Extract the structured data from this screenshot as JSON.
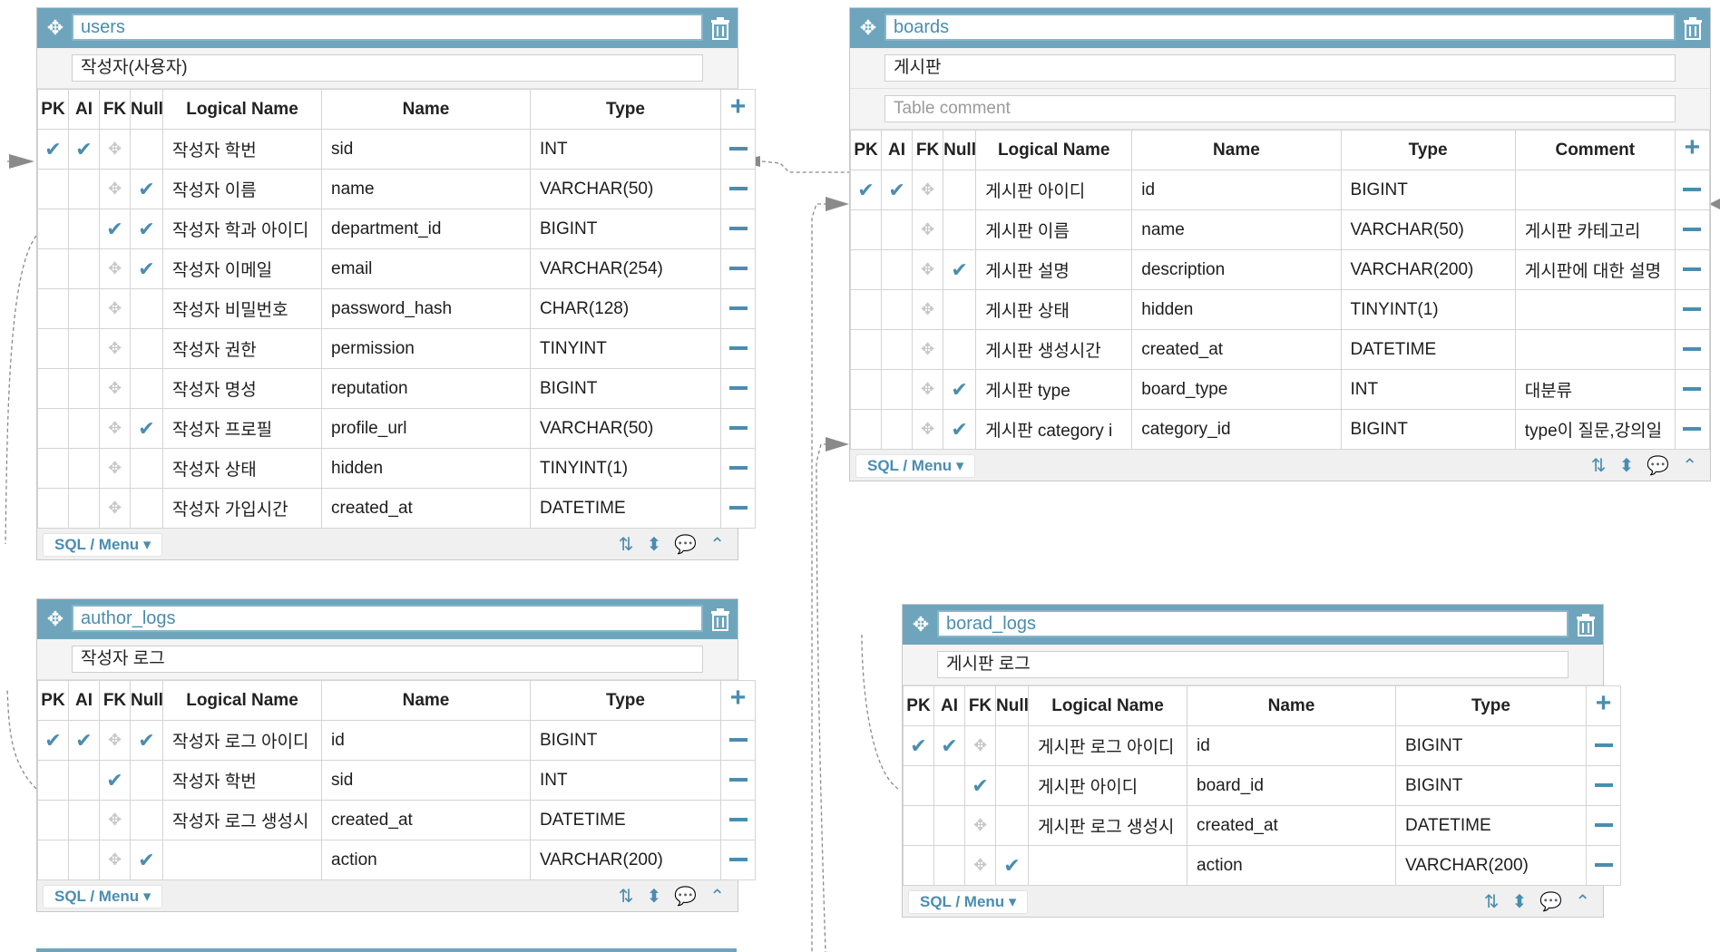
{
  "icons": {
    "move": "move-icon",
    "trash": "trash-icon",
    "check": "check-icon",
    "add": "plus-icon",
    "remove": "minus-icon",
    "sort": "sort-az-icon",
    "order": "sort-updown-icon",
    "comment": "comment-icon",
    "collapse": "chevron-up-icon"
  },
  "colors": {
    "accent": "#6ea5bd",
    "link": "#4a8db0"
  },
  "ui": {
    "sql_menu_label": "SQL / Menu ▾"
  },
  "headers": {
    "pk": "PK",
    "ai": "AI",
    "fk": "FK",
    "null": "Null",
    "logical": "Logical Name",
    "name": "Name",
    "type": "Type",
    "comment": "Comment"
  },
  "tables": {
    "users": {
      "name": "users",
      "comment": "작성자(사용자)",
      "rows": [
        {
          "logical": "작성자 학번",
          "name": "sid",
          "type": "INT",
          "pk": true,
          "ai": true,
          "fk": false,
          "null": false
        },
        {
          "logical": "작성자 이름",
          "name": "name",
          "type": "VARCHAR(50)",
          "pk": false,
          "ai": false,
          "fk": false,
          "null": true
        },
        {
          "logical": "작성자 학과 아이디",
          "name": "department_id",
          "type": "BIGINT",
          "pk": false,
          "ai": false,
          "fk": true,
          "null": true
        },
        {
          "logical": "작성자 이메일",
          "name": "email",
          "type": "VARCHAR(254)",
          "pk": false,
          "ai": false,
          "fk": false,
          "null": true
        },
        {
          "logical": "작성자 비밀번호",
          "name": "password_hash",
          "type": "CHAR(128)",
          "pk": false,
          "ai": false,
          "fk": false,
          "null": false
        },
        {
          "logical": "작성자 권한",
          "name": "permission",
          "type": "TINYINT",
          "pk": false,
          "ai": false,
          "fk": false,
          "null": false
        },
        {
          "logical": "작성자 명성",
          "name": "reputation",
          "type": "BIGINT",
          "pk": false,
          "ai": false,
          "fk": false,
          "null": false
        },
        {
          "logical": "작성자 프로필",
          "name": "profile_url",
          "type": "VARCHAR(50)",
          "pk": false,
          "ai": false,
          "fk": false,
          "null": true
        },
        {
          "logical": "작성자 상태",
          "name": "hidden",
          "type": "TINYINT(1)",
          "pk": false,
          "ai": false,
          "fk": false,
          "null": false
        },
        {
          "logical": "작성자 가입시간",
          "name": "created_at",
          "type": "DATETIME",
          "pk": false,
          "ai": false,
          "fk": false,
          "null": false
        }
      ]
    },
    "boards": {
      "name": "boards",
      "comment": "게시판",
      "table_comment_placeholder": "Table comment",
      "rows": [
        {
          "logical": "게시판 아이디",
          "name": "id",
          "type": "BIGINT",
          "comment": "",
          "pk": true,
          "ai": true,
          "fk": false,
          "null": false
        },
        {
          "logical": "게시판 이름",
          "name": "name",
          "type": "VARCHAR(50)",
          "comment": "게시판 카테고리",
          "pk": false,
          "ai": false,
          "fk": false,
          "null": false
        },
        {
          "logical": "게시판 설명",
          "name": "description",
          "type": "VARCHAR(200)",
          "comment": "게시판에 대한 설명",
          "pk": false,
          "ai": false,
          "fk": false,
          "null": true
        },
        {
          "logical": "게시판 상태",
          "name": "hidden",
          "type": "TINYINT(1)",
          "comment": "",
          "pk": false,
          "ai": false,
          "fk": false,
          "null": false
        },
        {
          "logical": "게시판 생성시간",
          "name": "created_at",
          "type": "DATETIME",
          "comment": "",
          "pk": false,
          "ai": false,
          "fk": false,
          "null": false
        },
        {
          "logical": "게시판 type",
          "name": "board_type",
          "type": "INT",
          "comment": "대분류",
          "pk": false,
          "ai": false,
          "fk": false,
          "null": true
        },
        {
          "logical": "게시판 category i",
          "name": "category_id",
          "type": "BIGINT",
          "comment": "type이 질문,강의일",
          "pk": false,
          "ai": false,
          "fk": false,
          "null": true
        }
      ]
    },
    "author_logs": {
      "name": "author_logs",
      "comment": "작성자 로그",
      "rows": [
        {
          "logical": "작성자 로그 아이디",
          "name": "id",
          "type": "BIGINT",
          "pk": true,
          "ai": true,
          "fk": false,
          "null": true
        },
        {
          "logical": "작성자 학번",
          "name": "sid",
          "type": "INT",
          "pk": false,
          "ai": false,
          "fk": true,
          "null": false
        },
        {
          "logical": "작성자 로그 생성시",
          "name": "created_at",
          "type": "DATETIME",
          "pk": false,
          "ai": false,
          "fk": false,
          "null": false
        },
        {
          "logical": "",
          "name": "action",
          "type": "VARCHAR(200)",
          "pk": false,
          "ai": false,
          "fk": false,
          "null": true
        }
      ]
    },
    "borad_logs": {
      "name": "borad_logs",
      "comment": "게시판 로그",
      "rows": [
        {
          "logical": "게시판 로그 아이디",
          "name": "id",
          "type": "BIGINT",
          "pk": true,
          "ai": true,
          "fk": false,
          "null": false
        },
        {
          "logical": "게시판 아이디",
          "name": "board_id",
          "type": "BIGINT",
          "pk": false,
          "ai": false,
          "fk": true,
          "null": false
        },
        {
          "logical": "게시판 로그 생성시",
          "name": "created_at",
          "type": "DATETIME",
          "pk": false,
          "ai": false,
          "fk": false,
          "null": false
        },
        {
          "logical": "",
          "name": "action",
          "type": "VARCHAR(200)",
          "pk": false,
          "ai": false,
          "fk": false,
          "null": true
        }
      ]
    }
  }
}
